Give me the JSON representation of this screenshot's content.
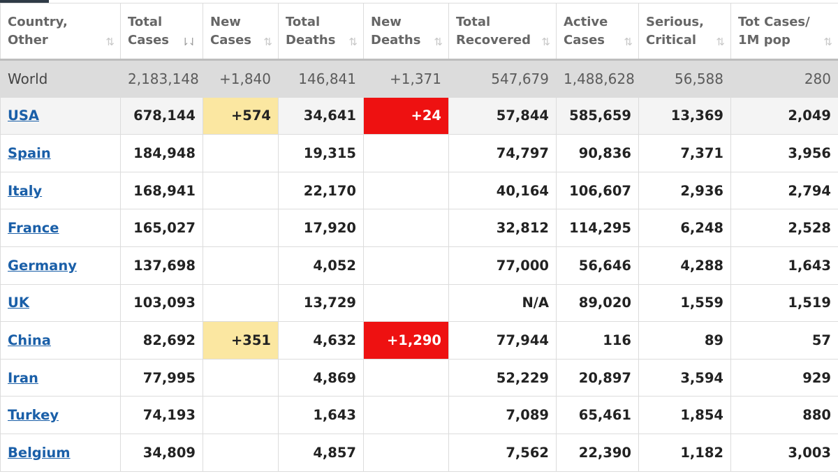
{
  "columns": [
    {
      "key": "country",
      "label": "Country,\nOther"
    },
    {
      "key": "total_cases",
      "label": "Total\nCases"
    },
    {
      "key": "new_cases",
      "label": "New\nCases"
    },
    {
      "key": "total_deaths",
      "label": "Total\nDeaths"
    },
    {
      "key": "new_deaths",
      "label": "New\nDeaths"
    },
    {
      "key": "total_recovered",
      "label": "Total\nRecovered"
    },
    {
      "key": "active_cases",
      "label": "Active\nCases"
    },
    {
      "key": "serious_critical",
      "label": "Serious,\nCritical"
    },
    {
      "key": "tot_cases_1m",
      "label": "Tot Cases/\n1M pop"
    }
  ],
  "sort_icons": {
    "default": "⇅",
    "active": "⇂⇃"
  },
  "world": {
    "country": "World",
    "total_cases": "2,183,148",
    "new_cases": "+1,840",
    "total_deaths": "146,841",
    "new_deaths": "+1,371",
    "total_recovered": "547,679",
    "active_cases": "1,488,628",
    "serious_critical": "56,588",
    "tot_cases_1m": "280"
  },
  "rows": [
    {
      "country": "USA",
      "total_cases": "678,144",
      "new_cases": "+574",
      "total_deaths": "34,641",
      "new_deaths": "+24",
      "total_recovered": "57,844",
      "active_cases": "585,659",
      "serious_critical": "13,369",
      "tot_cases_1m": "2,049"
    },
    {
      "country": "Spain",
      "total_cases": "184,948",
      "new_cases": "",
      "total_deaths": "19,315",
      "new_deaths": "",
      "total_recovered": "74,797",
      "active_cases": "90,836",
      "serious_critical": "7,371",
      "tot_cases_1m": "3,956"
    },
    {
      "country": "Italy",
      "total_cases": "168,941",
      "new_cases": "",
      "total_deaths": "22,170",
      "new_deaths": "",
      "total_recovered": "40,164",
      "active_cases": "106,607",
      "serious_critical": "2,936",
      "tot_cases_1m": "2,794"
    },
    {
      "country": "France",
      "total_cases": "165,027",
      "new_cases": "",
      "total_deaths": "17,920",
      "new_deaths": "",
      "total_recovered": "32,812",
      "active_cases": "114,295",
      "serious_critical": "6,248",
      "tot_cases_1m": "2,528"
    },
    {
      "country": "Germany",
      "total_cases": "137,698",
      "new_cases": "",
      "total_deaths": "4,052",
      "new_deaths": "",
      "total_recovered": "77,000",
      "active_cases": "56,646",
      "serious_critical": "4,288",
      "tot_cases_1m": "1,643"
    },
    {
      "country": "UK",
      "total_cases": "103,093",
      "new_cases": "",
      "total_deaths": "13,729",
      "new_deaths": "",
      "total_recovered": "N/A",
      "active_cases": "89,020",
      "serious_critical": "1,559",
      "tot_cases_1m": "1,519"
    },
    {
      "country": "China",
      "total_cases": "82,692",
      "new_cases": "+351",
      "total_deaths": "4,632",
      "new_deaths": "+1,290",
      "total_recovered": "77,944",
      "active_cases": "116",
      "serious_critical": "89",
      "tot_cases_1m": "57"
    },
    {
      "country": "Iran",
      "total_cases": "77,995",
      "new_cases": "",
      "total_deaths": "4,869",
      "new_deaths": "",
      "total_recovered": "52,229",
      "active_cases": "20,897",
      "serious_critical": "3,594",
      "tot_cases_1m": "929"
    },
    {
      "country": "Turkey",
      "total_cases": "74,193",
      "new_cases": "",
      "total_deaths": "1,643",
      "new_deaths": "",
      "total_recovered": "7,089",
      "active_cases": "65,461",
      "serious_critical": "1,854",
      "tot_cases_1m": "880"
    },
    {
      "country": "Belgium",
      "total_cases": "34,809",
      "new_cases": "",
      "total_deaths": "4,857",
      "new_deaths": "",
      "total_recovered": "7,562",
      "active_cases": "22,390",
      "serious_critical": "1,182",
      "tot_cases_1m": "3,003"
    }
  ],
  "colors": {
    "new_cases_highlight": "#fbe7a1",
    "new_deaths_highlight": "#ee1111",
    "country_link": "#1a5fa8",
    "world_row_bg": "#dcdcdc"
  }
}
